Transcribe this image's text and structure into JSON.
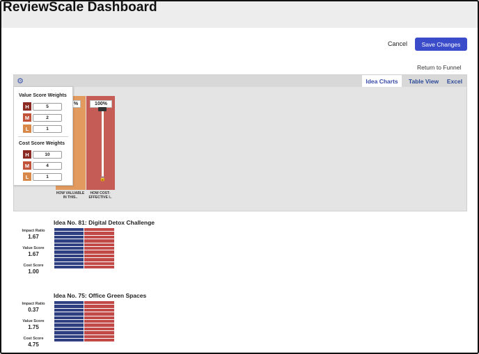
{
  "app": {
    "title": "ReviewScale Dashboard"
  },
  "toolbar": {
    "cancel_label": "Cancel",
    "save_label": "Save Changes",
    "return_label": "Return to Funnel"
  },
  "tabs": [
    {
      "label": "Idea Charts",
      "active": true
    },
    {
      "label": "Table View",
      "active": false
    },
    {
      "label": "Excel",
      "active": false
    }
  ],
  "bar_columns": [
    {
      "label_line1": "HOW VALUABLE",
      "label_line2": "IN THIS..",
      "pct": "%",
      "color": "#e39a5f"
    },
    {
      "label_line1": "HOW COST-",
      "label_line2": "EFFECTIVE I..",
      "pct": "100%",
      "color": "#c55c55"
    }
  ],
  "weights": {
    "value_heading": "Value Score Weights",
    "cost_heading": "Cost Score Weights",
    "value_rows": [
      {
        "letter": "H",
        "value": "5",
        "color": "#8b2a22"
      },
      {
        "letter": "M",
        "value": "2",
        "color": "#c0533a"
      },
      {
        "letter": "L",
        "value": "1",
        "color": "#d88848"
      }
    ],
    "cost_rows": [
      {
        "letter": "H",
        "value": "10",
        "color": "#8b2a22"
      },
      {
        "letter": "M",
        "value": "4",
        "color": "#c0533a"
      },
      {
        "letter": "L",
        "value": "1",
        "color": "#d88848"
      }
    ]
  },
  "ideas": [
    {
      "title": "Idea No. 81: Digital Detox Challenge",
      "impact_label": "Impact Ratio",
      "impact_value": "1.67",
      "value_label": "Value Score",
      "value_value": "1.67",
      "cost_label": "Cost Score",
      "cost_value": "1.00",
      "left_color": "#2e3f82",
      "right_color": "#c14a48"
    },
    {
      "title": "Idea No. 75: Office Green Spaces",
      "impact_label": "Impact Ratio",
      "impact_value": "0.37",
      "value_label": "Value Score",
      "value_value": "1.75",
      "cost_label": "Cost Score",
      "cost_value": "4.75",
      "left_color": "#2e3f82",
      "right_color": "#c14a48"
    }
  ],
  "icons": {
    "settings": "gear-icon",
    "lock": "lock-icon"
  },
  "colors": {
    "accent": "#3b4ccb",
    "tab_text": "#2c4a99"
  }
}
